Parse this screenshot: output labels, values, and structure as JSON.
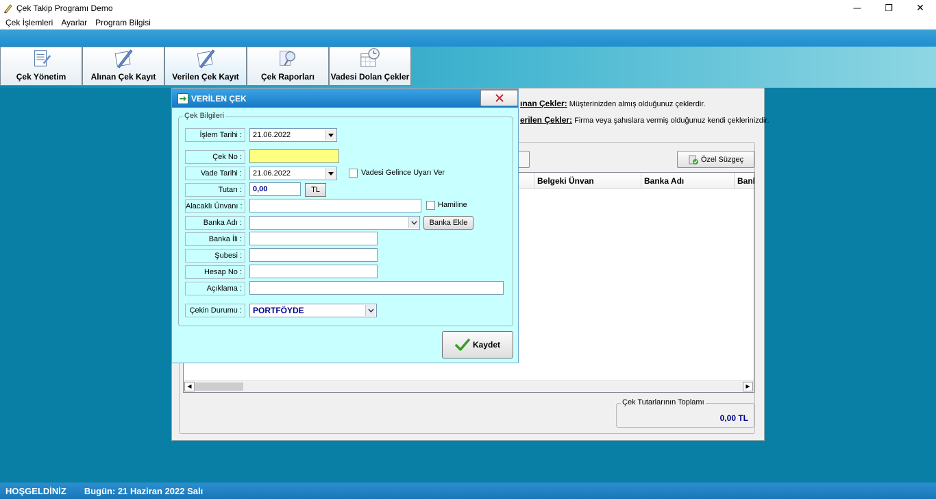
{
  "window": {
    "title": "Çek Takip Programı Demo",
    "minimize_glyph": "—",
    "restore_glyph": "❐",
    "close_glyph": "✕"
  },
  "menu": [
    "Çek İşlemleri",
    "Ayarlar",
    "Program Bilgisi"
  ],
  "toolbar": [
    {
      "label": "Çek Yönetim",
      "icon": "document-icon"
    },
    {
      "label": "Alınan Çek Kayıt",
      "icon": "pen-document-icon"
    },
    {
      "label": "Verilen Çek Kayıt",
      "icon": "pen-document-icon"
    },
    {
      "label": "Çek Raporları",
      "icon": "report-search-icon"
    },
    {
      "label": "Vadesi Dolan Çekler",
      "icon": "calendar-clock-icon"
    }
  ],
  "main": {
    "legend1_title": "ınan Çekler:",
    "legend1_text": "Müşterinizden almış olduğunuz çeklerdir.",
    "legend2_title": "erilen Çekler:",
    "legend2_text": "Firma veya şahıslara vermiş olduğunuz kendi çeklerinizdir.",
    "filter_button": "Özel Süzgeç",
    "columns": [
      "Belgeki Ünvan",
      "Banka Adı",
      "Banl"
    ],
    "total_caption": "Çek Tutarlarının Toplamı",
    "total_value": "0,00 TL"
  },
  "dialog": {
    "title": "VERİLEN ÇEK",
    "group_caption": "Çek Bilgileri",
    "labels": {
      "islem_tarihi": "İşlem Tarihi :",
      "cek_no": "Çek No :",
      "vade_tarihi": "Vade Tarihi :",
      "tutari": "Tutarı :",
      "alacakli": "Alacaklı Ünvanı :",
      "banka_adi": "Banka Adı :",
      "banka_ili": "Banka İli :",
      "subesi": "Şubesi :",
      "hesap_no": "Hesap No :",
      "aciklama": "Açıklama :",
      "cekin_durumu": "Çekin Durumu :"
    },
    "values": {
      "islem_tarihi": "21.06.2022",
      "cek_no": "",
      "vade_tarihi": "21.06.2022",
      "tutari": "0,00",
      "currency": "TL",
      "alacakli": "",
      "banka_adi": "",
      "banka_ili": "",
      "subesi": "",
      "hesap_no": "",
      "aciklama": "",
      "cekin_durumu": "PORTFÖYDE"
    },
    "vade_uyari_label": "Vadesi Gelince Uyarı Ver",
    "hamiline_label": "Hamiline",
    "banka_ekle_button": "Banka Ekle",
    "save_button": "Kaydet"
  },
  "status": {
    "welcome": "HOŞGELDİNİZ",
    "today": "Bugün: 21 Haziran 2022 Salı"
  }
}
